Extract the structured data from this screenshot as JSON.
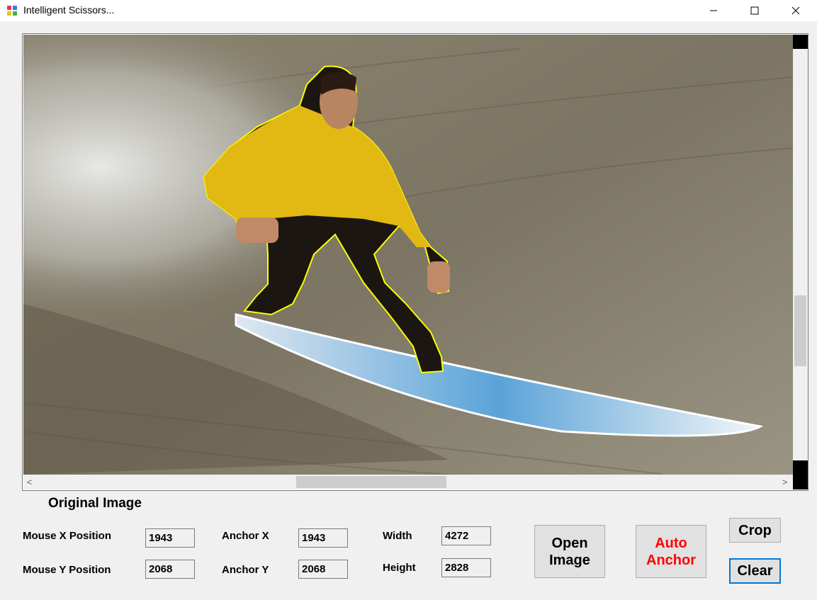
{
  "window": {
    "title": "Intelligent Scissors..."
  },
  "canvas": {
    "scroll_left_arrow": "<",
    "scroll_right_arrow": ">",
    "outline_color": "#ffff00"
  },
  "panel": {
    "section_title": "Original Image",
    "mouse_x_label": "Mouse X Position",
    "mouse_x_value": "1943",
    "mouse_y_label": "Mouse Y Position",
    "mouse_y_value": "2068",
    "anchor_x_label": "Anchor X",
    "anchor_x_value": "1943",
    "anchor_y_label": "Anchor Y",
    "anchor_y_value": "2068",
    "width_label": "Width",
    "width_value": "4272",
    "height_label": "Height",
    "height_value": "2828"
  },
  "buttons": {
    "open_image": "Open Image",
    "auto_anchor": "Auto Anchor",
    "crop": "Crop",
    "clear": "Clear",
    "auto_anchor_color": "#ff0000"
  }
}
